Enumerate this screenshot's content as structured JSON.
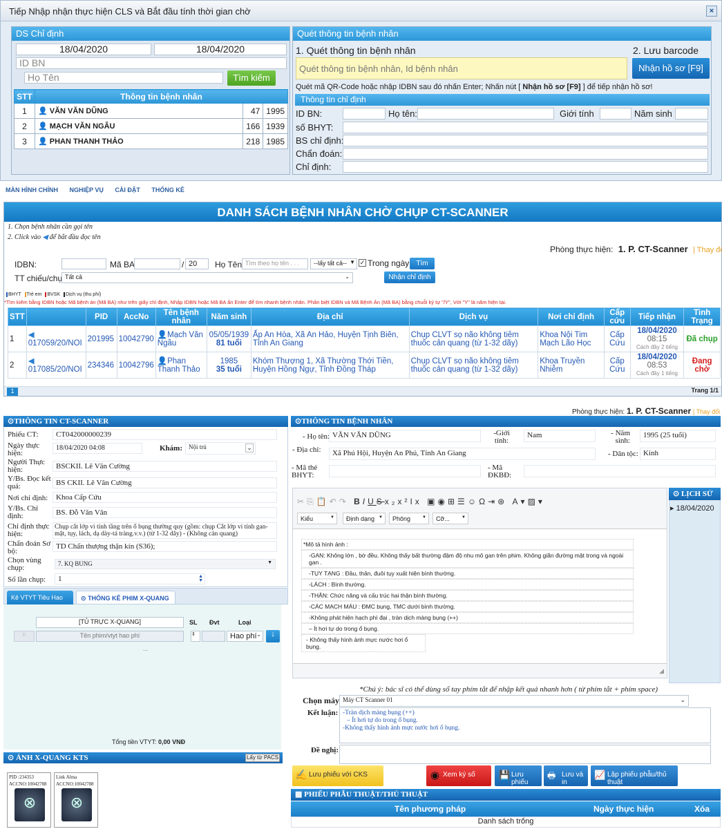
{
  "dialog": {
    "title": "Tiếp Nhập nhận thực hiện CLS và Bắt đầu tính thời gian chờ",
    "close": "×",
    "ds": {
      "header": "DS Chỉ định",
      "date_from": "18/04/2020",
      "date_to": "18/04/2020",
      "idbn_placeholder": "ID BN",
      "name_placeholder": "Họ Tên",
      "search_btn": "Tìm kiếm",
      "col_stt": "STT",
      "col_info": "Thông tin bệnh nhân",
      "rows": [
        {
          "stt": "1",
          "name": "VĂN VĂN DŨNG",
          "a": "47",
          "b": "1995"
        },
        {
          "stt": "2",
          "name": "MẠCH VĂN NGÂU",
          "a": "166",
          "b": "1939"
        },
        {
          "stt": "3",
          "name": "PHAN THANH THẢO",
          "a": "218",
          "b": "1985"
        }
      ]
    },
    "scan": {
      "header": "Quét thông tin bệnh nhân",
      "step1": "1. Quét thông tin bệnh nhân",
      "step2": "2. Lưu barcode",
      "scan_placeholder": "Quét thông tin bệnh nhân, Id bệnh nhân",
      "receive_btn": "Nhận hồ sơ [F9]",
      "hint_pre": "Quét mã QR-Code hoặc nhập IDBN sau đó nhấn Enter; Nhấn nút [",
      "hint_btn": " Nhận hồ sơ [F9] ",
      "hint_post": "] để tiếp nhận hồ sơ!",
      "info_header": "Thông tin chỉ định",
      "id_bn": "ID BN:",
      "ho_ten": "Họ tên:",
      "gioi_tinh": "Giới tính",
      "nam_sinh": "Năm sinh",
      "so_bhyt": "số BHYT:",
      "bs_chi_dinh": "BS chỉ định:",
      "chan_doan": "Chẩn đoán:",
      "chi_dinh": "Chỉ định:"
    }
  },
  "nav": [
    "MÀN HÌNH CHÍNH",
    "NGHIỆP VỤ",
    "CÀI ĐẶT",
    "THỐNG KÊ"
  ],
  "list": {
    "title": "DANH SÁCH BỆNH NHÂN CHỜ CHỤP CT-SCANNER",
    "instr1": "1. Chọn bệnh nhân cần gọi tên",
    "instr2_pre": "2. Click vào",
    "instr2_post": "để bắt đầu đọc tên",
    "room_label": "Phòng thực hiện:",
    "room_value": "1. P. CT-Scanner",
    "change": "| Thay đổi",
    "idbn_label": "IDBN:",
    "ma_ba_label": "Mã BA:",
    "ma_ba_suffix": "20",
    "ho_ten_label": "Họ Tên:",
    "name_placeholder": "Tìm theo họ tên . . .",
    "all_option": "--lấy tất cả--",
    "in_day": "Trong ngày",
    "find_btn": "Tìm",
    "tt_label": "TT chiếu/chụp:",
    "tt_value": "Tất cả",
    "nhan_btn": "Nhận chỉ định",
    "legend": [
      "BHYT",
      "Trẻ em",
      "BVSK",
      "Dịch vụ (thu phí)"
    ],
    "warning": "*Tìm kiếm bằng IDBN hoặc Mã bệnh án (Mã BA) như trên giấy chỉ định, Nhập IDBN hoặc Mã BA ấn Enter để tìm nhanh bệnh nhân. Phân biệt IDBN và Mã Bệnh Án (Mã BA) bằng chuỗi ký tự \"/Y\", Với \"Y\" là năm hiện tại.",
    "columns": [
      "STT",
      "",
      "PID",
      "AccNo",
      "Tên bệnh nhân",
      "Năm sinh",
      "Địa chỉ",
      "Dịch vụ",
      "Nơi chỉ định",
      "Cấp cứu",
      "Tiếp nhận",
      "Tình Trạng"
    ],
    "rows": [
      {
        "stt": "1",
        "code": "017059/20/NOI",
        "pid": "201995",
        "acc": "10042790",
        "name": "Mạch Văn Ngầu",
        "dob": "05/05/1939",
        "age": "81 tuổi",
        "addr": "Ấp An Hòa, Xã An Hảo, Huyện Tịnh Biên, Tỉnh An Giang",
        "svc": "Chụp CLVT sọ não không tiêm thuốc cản quang (từ 1-32 dãy)",
        "place": "Khoa Nội Tim Mạch Lão Học",
        "er": "Cấp Cứu",
        "date": "18/04/2020",
        "time": "08:15",
        "ago": "Cách đây 2 tiếng",
        "status": "Đã chụp"
      },
      {
        "stt": "2",
        "code": "017085/20/NOI",
        "pid": "234346",
        "acc": "10042796",
        "name": "Phan Thanh Thảo",
        "dob": "1985",
        "age": "35 tuổi",
        "addr": "Khóm Thượng 1, Xã Thường Thới Tiền, Huyện Hồng Ngự, Tỉnh Đồng Tháp",
        "svc": "Chụp CLVT sọ não không tiêm thuốc cản quang (từ 1-32 dãy)",
        "place": "Khoa Truyền Nhiễm",
        "er": "Cấp Cứu",
        "date": "18/04/2020",
        "time": "08:53",
        "ago": "Cách đây 1 tiếng",
        "status": "Đang chờ"
      }
    ],
    "page_num": "1",
    "page_label": "Trang 1/1"
  },
  "detail": {
    "room_label": "Phòng thực hiện:",
    "room_value": "1. P. CT-Scanner",
    "change": "| Thay đổi",
    "ct": {
      "header": "THÔNG TIN CT-SCANNER",
      "phieu_lbl": "Phiếu CT:",
      "phieu": "CT042000000239",
      "ngay_lbl": "Ngày thực hiện:",
      "ngay": "18/04/2020 04:08",
      "kham_lbl": "Khám:",
      "kham": "Nội trú",
      "nguoi_lbl": "Người Thực hiện:",
      "nguoi": "BSCKII. Lê Văn Cường",
      "doc_lbl": "Y/Bs. Đọc kết quả:",
      "doc": "BS CKII. Lê Văn Cường",
      "noi_lbl": "Nơi chỉ định:",
      "noi": "Khoa Cấp Cứu",
      "ybs_lbl": "Y/Bs. Chỉ định:",
      "ybs": "BS. Đỗ Văn Vân",
      "cdth_lbl": "Chỉ định thực hiện:",
      "cdth": "Chụp cắt lớp vi tính tầng trên ổ bụng thường quy (gồm: chụp Cắt lớp vi tính gan-mật, tụy, lách, dạ dày-tá tràng.v.v.) (từ 1-32 dãy) - (Không cản quang)",
      "cdsb_lbl": "Chẩn đoán Sơ bộ:",
      "cdsb": "TD Chấn thượng thận kín (S36);",
      "vung_lbl": "Chọn vùng chụp:",
      "vung": "7. KQ BUNG",
      "solan_lbl": "Số lần chụp:",
      "solan": "1"
    },
    "tabs": [
      "Kê VTYT Tiêu Hao",
      "THỐNG KÊ PHIM X-QUANG"
    ],
    "vtyt": {
      "tu_truc": "[TỦ TRỰC X-QUANG]",
      "sl": "SL",
      "dvt": "Đvt",
      "loai": "Loại",
      "search_placeholder": "Tên phim/vtyt hao phí",
      "hao_phi": "Hao phí",
      "dots": "...",
      "total_label": "Tổng tiền VTYT:",
      "total_value": "0,00 VNĐ"
    },
    "xray": {
      "header": "ẢNH X-QUANG KTS",
      "btn": "Lấy từ PACS",
      "thumbs": [
        {
          "l1": "PID      :234353",
          "l2": "ACCNO:10042788"
        },
        {
          "l1": "Link Alma",
          "l2": "ACCNO:10042788"
        }
      ]
    },
    "bn": {
      "header": "THÔNG TIN BỆNH NHÂN",
      "hoten_lbl": "- Họ tên:",
      "hoten": "VĂN VĂN DŨNG",
      "gioi_lbl": "-Giới tính:",
      "gioi": "Nam",
      "namsinh_lbl": "- Năm sinh:",
      "namsinh": "1995 (25 tuổi)",
      "diachi_lbl": "- Địa chỉ:",
      "diachi": "Xã Phú Hội, Huyện An Phú, Tỉnh An Giang",
      "dantoc_lbl": "- Dân tộc:",
      "dantoc": "Kinh",
      "mathe_lbl": "- Mã thẻ BHYT:",
      "madk_lbl": "- Mã ĐKBĐ:"
    },
    "editor": {
      "kieu": "Kiểu",
      "dinhdang": "Định dạng",
      "phong": "Phông",
      "co": "Cỡ...",
      "lines": [
        "*Mô tả hình ảnh :",
        "-GAN: Không lớn , bờ đều. Không thấy bất thường đậm độ nhu mô gan trên phim. Không giãn đường mật trong và ngoài gan .",
        "-TỤY TẠNG : Đầu, thân, đuôi tụy xuất hiện bình thường.",
        "-LÁCH :  Bình thường.",
        "-THẬN: Chức năng và cấu trúc hai thận bình thường.",
        "-CÁC MẠCH MÁU : ĐMC bụng, TMC dưới bình thường.",
        "-Không phát hiện hạch phì đại  , tràn dịch màng bụng (++)",
        "– Ít hơi tự do trong ổ bụng.",
        "- Không thấy hình ảnh mực nước hơi ổ bụng."
      ]
    },
    "history": {
      "header": "LỊCH SỬ",
      "item": "18/04/2020"
    },
    "note": "*Chú ý: bác sĩ có thể dùng sổ tay phím tắt để nhập kết quả nhanh hơn ( từ phím tắt + phím space)",
    "chon_may_lbl": "Chọn máy:",
    "chon_may": "Máy CT Scanner 01",
    "ketluan_lbl": "Kết luận:",
    "ketluan": [
      "-Tràn dịch màng bụng (++)",
      "– Ít hơi tự do trong ổ bụng.",
      "-Không thấy hình ảnh mực nước hơi ổ bụng."
    ],
    "denghi_lbl": "Đề nghị:",
    "buttons": {
      "cks": "Lưu phiếu với CKS",
      "xem": "Xem ký số",
      "luu": "Lưu phiếu",
      "luuin": "Lưu và in",
      "lap": "Lập phiếu phẫu/thủ thuật"
    },
    "surgery": {
      "header": "PHIẾU PHẪU THUẬT/THỦ THUẬT",
      "cols": [
        "Tên phương pháp",
        "Ngày thực hiện",
        "Xóa"
      ],
      "empty": "Danh sách trống"
    }
  },
  "colors": {
    "accent": "#1f87cf",
    "er_red": "#d51d1d",
    "done_green": "#2aa02a",
    "wait_red": "#d51d1d"
  }
}
